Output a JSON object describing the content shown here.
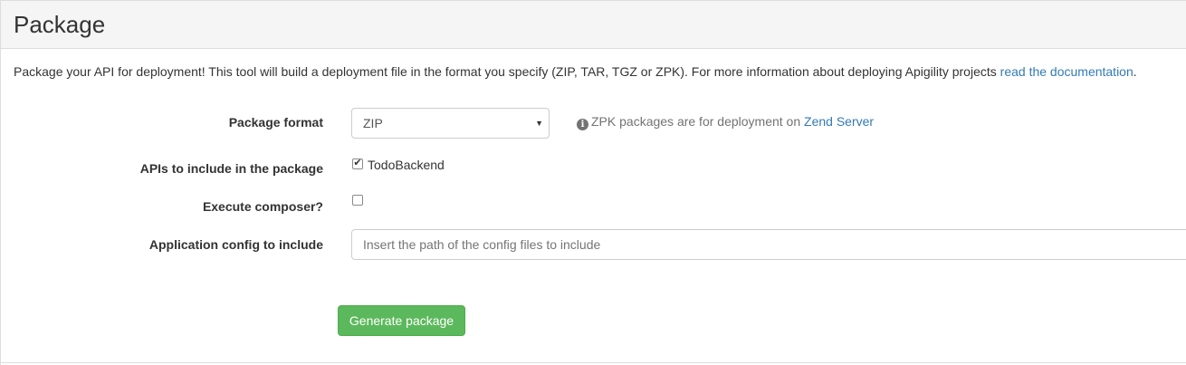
{
  "header": {
    "title": "Package"
  },
  "intro": {
    "text": "Package your API for deployment! This tool will build a deployment file in the format you specify (ZIP, TAR, TGZ or ZPK). For more information about deploying Apigility projects ",
    "link_text": "read the documentation",
    "suffix": "."
  },
  "form": {
    "package_format": {
      "label": "Package format",
      "selected": "ZIP",
      "help_text": "ZPK packages are for deployment on ",
      "help_link": "Zend Server"
    },
    "apis": {
      "label": "APIs to include in the package",
      "items": [
        {
          "label": "TodoBackend",
          "checked": true
        }
      ]
    },
    "composer": {
      "label": "Execute composer?",
      "checked": false
    },
    "app_config": {
      "label": "Application config to include",
      "placeholder": "Insert the path of the config files to include",
      "value": ""
    },
    "submit_label": "Generate package"
  },
  "icons": {
    "info": "info-circle-icon",
    "select_arrow": "caret-down-icon"
  },
  "colors": {
    "primary_link": "#337ab7",
    "success_button": "#5cb85c",
    "heading_bg": "#f5f5f5"
  }
}
